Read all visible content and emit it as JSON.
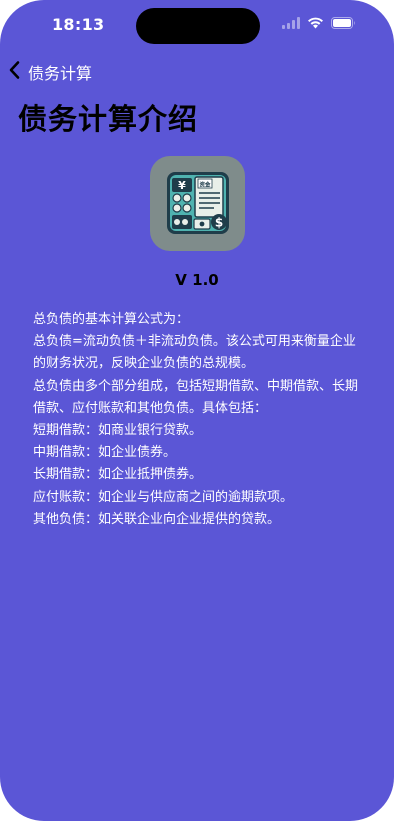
{
  "status_bar": {
    "time": "18:13"
  },
  "nav": {
    "back_label": "债务计算"
  },
  "page": {
    "title": "债务计算介绍",
    "version": "V 1.0"
  },
  "description": {
    "lines": [
      "总负债的基本计算公式为：",
      "总负债=流动负债＋非流动负债。该公式可用来衡量企业的财务状况，反映企业负债的总规模。",
      "总负债由多个部分组成，包括短期借款、中期借款、长期借款、应付账款和其他负债。具体包括：",
      "短期借款：如商业银行贷款。",
      "中期借款：如企业债券。",
      "长期借款：如企业抵押债券。",
      "应付账款：如企业与供应商之间的逾期款项。",
      "其他负债：如关联企业向企业提供的贷款。"
    ]
  },
  "app_icon": {
    "badge_text": "资金",
    "currency_symbols": [
      "¥",
      "$"
    ]
  },
  "colors": {
    "background": "#5b56d6",
    "title_text": "#000000",
    "body_text": "#ffffff",
    "icon_tile": "#7f8c8b"
  },
  "icons": {
    "back": "chevron-left-icon",
    "wifi": "wifi-icon",
    "battery": "battery-icon",
    "cellular": "cellular-signal-icon"
  }
}
